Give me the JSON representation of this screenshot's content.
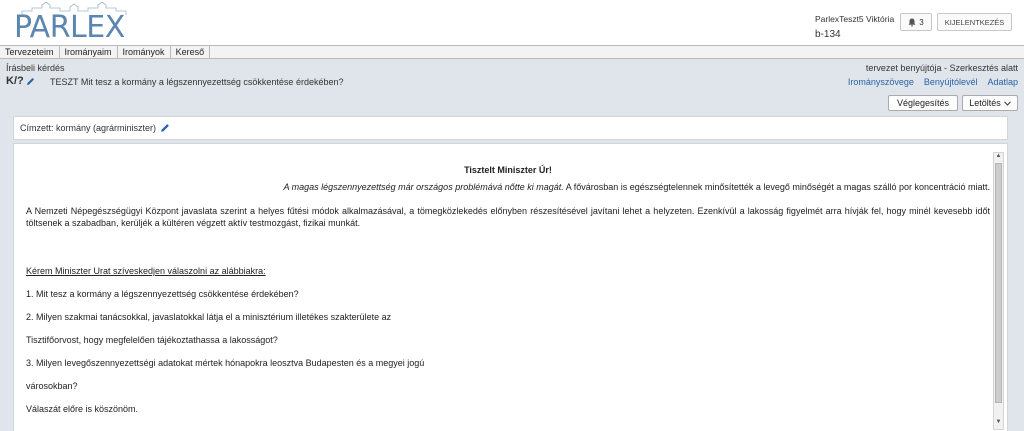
{
  "logo": {
    "text": "PARLEX"
  },
  "user": {
    "name": "ParlexTeszt5 Viktória",
    "code": "b-134",
    "notification_count": "3",
    "logout_label": "KIJELENTKEZÉS"
  },
  "menu": {
    "items": [
      "Tervezeteim",
      "Irományaim",
      "Irományok",
      "Kereső"
    ]
  },
  "document": {
    "type": "Írásbeli kérdés",
    "id": "K/?",
    "title": "TESZT Mit tesz a kormány a légszennyezettség csökkentése érdekében?",
    "status": "tervezet benyújtója - Szerkesztés alatt",
    "links": [
      "Irományszövege",
      "Benyújtólevél",
      "Adatlap"
    ],
    "finalize_label": "Véglegesítés",
    "download_label": "Letöltés"
  },
  "recipient": {
    "label": "Címzett: kormány (agrárminiszter)"
  },
  "content": {
    "salutation": "Tisztelt Miniszter Úr!",
    "intro_italic": "A magas légszennyezettség már országos problémává nőtte ki magát.",
    "intro_rest": " A fővárosban is egészségtelennek minősítették a levegő minőségét a magas szálló por koncentráció miatt.",
    "paragraph": "A Nemzeti Népegészségügyi Központ javaslata szerint a helyes fűtési módok alkalmazásával, a tömegközlekedés előnyben részesítésével javítani lehet a helyzeten. Ezenkívül a lakosság figyelmét arra hívják fel, hogy minél kevesebb időt töltsenek a szabadban, kerüljék a kültéren végzett aktív testmozgást, fizikai munkát.",
    "request": "Kérem Miniszter Urat szíveskedjen válaszolni az alábbiakra:",
    "q1": "1. Mit tesz a kormány a légszennyezettség csökkentése érdekében?",
    "q2a": "2. Milyen szakmai tanácsokkal, javaslatokkal látja el a minisztérium illetékes szakterülete az",
    "q2b": "Tisztifőorvost, hogy megfelelően tájékoztathassa a lakosságot?",
    "q3a": "3. Milyen levegőszennyezettségi adatokat mértek hónapokra leosztva Budapesten és a megyei jogú",
    "q3b": "városokban?",
    "closing": "Válaszát előre is köszönöm."
  }
}
